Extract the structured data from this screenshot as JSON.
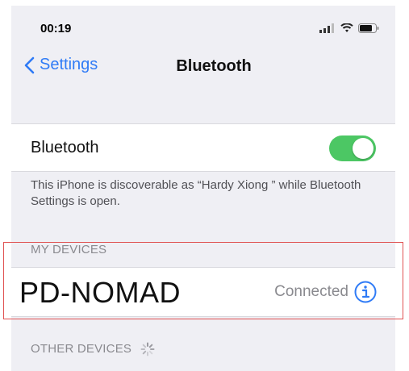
{
  "status_bar": {
    "time": "00:19"
  },
  "nav": {
    "back_label": "Settings",
    "title": "Bluetooth"
  },
  "bluetooth": {
    "label": "Bluetooth",
    "enabled": true,
    "discoverable_text": "This iPhone is discoverable as “Hardy Xiong ” while Bluetooth Settings is open."
  },
  "my_devices": {
    "header": "MY DEVICES",
    "items": [
      {
        "name": "PD-NOMAD",
        "status": "Connected"
      }
    ]
  },
  "other_devices": {
    "header": "OTHER DEVICES"
  },
  "colors": {
    "accent": "#2f7bf6",
    "toggle_on": "#4cc764",
    "highlight": "#e05252"
  }
}
